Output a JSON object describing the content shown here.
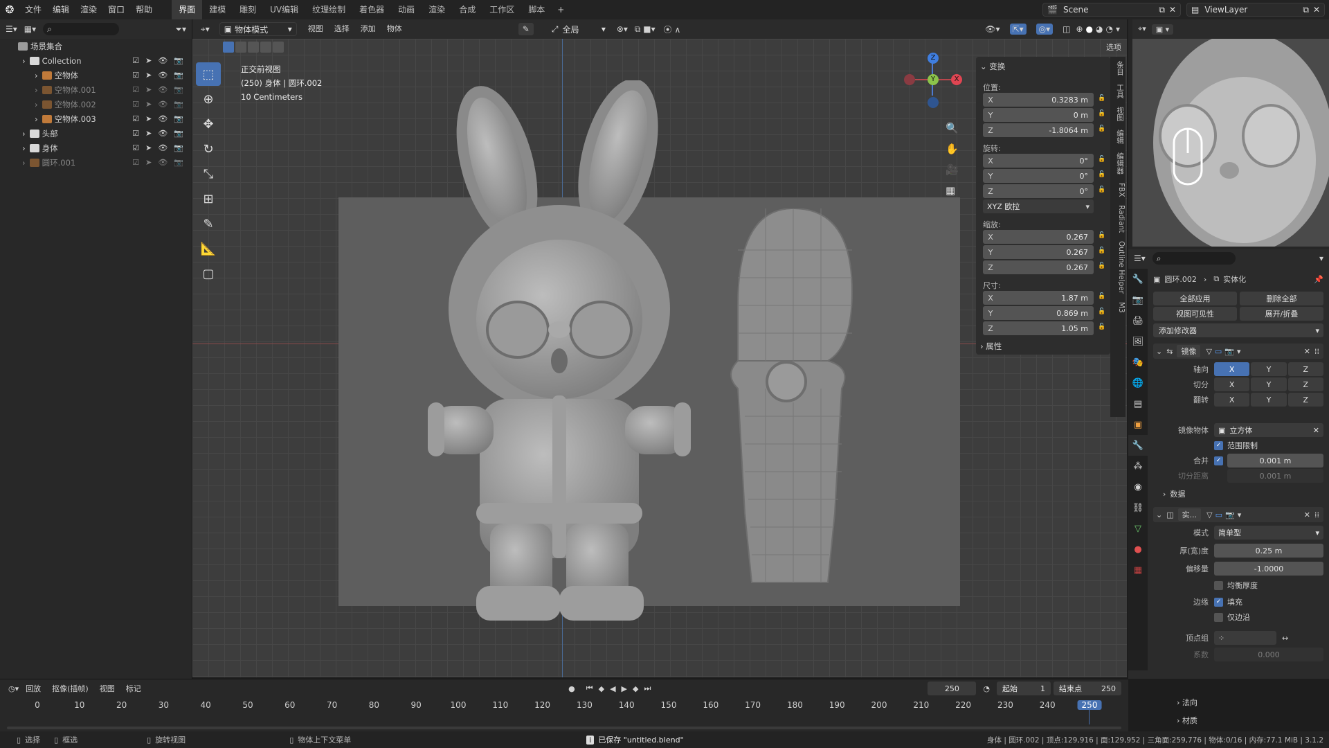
{
  "topbar": {
    "menus": [
      "文件",
      "编辑",
      "渲染",
      "窗口",
      "帮助"
    ],
    "workspaces": [
      "界面",
      "建模",
      "雕刻",
      "UV编辑",
      "纹理绘制",
      "着色器",
      "动画",
      "渲染",
      "合成",
      "工作区",
      "脚本"
    ],
    "add_tab": "+",
    "scene": "Scene",
    "view_layer": "ViewLayer"
  },
  "outliner": {
    "title": "场景集合",
    "rows": [
      {
        "name": "Collection",
        "indent": 1,
        "type": "collection"
      },
      {
        "name": "空物体",
        "indent": 2,
        "type": "empty"
      },
      {
        "name": "空物体.001",
        "indent": 2,
        "type": "empty",
        "dim": true
      },
      {
        "name": "空物体.002",
        "indent": 2,
        "type": "empty",
        "dim": true
      },
      {
        "name": "空物体.003",
        "indent": 2,
        "type": "empty"
      },
      {
        "name": "头部",
        "indent": 1,
        "type": "collection"
      },
      {
        "name": "身体",
        "indent": 1,
        "type": "collection"
      },
      {
        "name": "圆环.001",
        "indent": 1,
        "type": "mesh",
        "dim": true
      }
    ]
  },
  "viewport_header": {
    "mode": "物体模式",
    "menus": [
      "视图",
      "选择",
      "添加",
      "物体"
    ],
    "transform_orient": "全局",
    "options": "选项"
  },
  "viewport_info": {
    "view": "正交前视图",
    "object": "(250) 身体 | 圆环.002",
    "scale": "10 Centimeters"
  },
  "npanel": {
    "header": "变换",
    "location_label": "位置:",
    "location": [
      {
        "ax": "X",
        "v": "0.3283 m"
      },
      {
        "ax": "Y",
        "v": "0 m"
      },
      {
        "ax": "Z",
        "v": "-1.8064 m"
      }
    ],
    "rotation_label": "旋转:",
    "rotation": [
      {
        "ax": "X",
        "v": "0°"
      },
      {
        "ax": "Y",
        "v": "0°"
      },
      {
        "ax": "Z",
        "v": "0°"
      }
    ],
    "rotation_mode": "XYZ 欧拉",
    "scale_label": "缩放:",
    "scale": [
      {
        "ax": "X",
        "v": "0.267"
      },
      {
        "ax": "Y",
        "v": "0.267"
      },
      {
        "ax": "Z",
        "v": "0.267"
      }
    ],
    "dims_label": "尺寸:",
    "dims": [
      {
        "ax": "X",
        "v": "1.87 m"
      },
      {
        "ax": "Y",
        "v": "0.869 m"
      },
      {
        "ax": "Z",
        "v": "1.05 m"
      }
    ],
    "attributes": "属性"
  },
  "side_tabs": [
    "条目",
    "工具",
    "视图",
    "编辑",
    "编辑器",
    "FBX",
    "Radiant",
    "Outline Helper",
    "M3"
  ],
  "properties": {
    "breadcrumb_obj": "圆环.002",
    "breadcrumb_mod": "实体化",
    "apply_all": "全部应用",
    "delete_all": "删除全部",
    "viewport_vis": "视图可见性",
    "expand": "展开/折叠",
    "add_modifier": "添加修改器",
    "mirror": {
      "name": "镜像",
      "axis_label": "轴向",
      "bisect_label": "切分",
      "flip_label": "翻转",
      "axes": [
        "X",
        "Y",
        "Z"
      ],
      "mirror_object_label": "镜像物体",
      "mirror_object": "立方体",
      "clipping": "范围限制",
      "merge_label": "合并",
      "merge_value": "0.001 m",
      "bisect_dist_label": "切分距离",
      "bisect_dist": "0.001 m",
      "data": "数据"
    },
    "solidify": {
      "name": "实...",
      "mode_label": "模式",
      "mode": "简单型",
      "thickness_label": "厚(宽)度",
      "thickness": "0.25 m",
      "offset_label": "偏移量",
      "offset": "-1.0000",
      "even": "均衡厚度",
      "rim_label": "边缘",
      "fill": "填充",
      "only_rim": "仅边沿",
      "vgroup_label": "顶点组",
      "factor_label": "系数",
      "factor": "0.000",
      "normals": "法向",
      "materials": "材质"
    }
  },
  "timeline": {
    "menus": [
      "回放",
      "抠像(插帧)",
      "视图",
      "标记"
    ],
    "current": "250",
    "start_label": "起始",
    "start": "1",
    "end_label": "结束点",
    "end": "250",
    "ticks": [
      "0",
      "10",
      "20",
      "30",
      "40",
      "50",
      "60",
      "70",
      "80",
      "90",
      "100",
      "110",
      "120",
      "130",
      "140",
      "150",
      "160",
      "170",
      "180",
      "190",
      "200",
      "210",
      "220",
      "230",
      "240",
      "250"
    ]
  },
  "statusbar": {
    "select": "选择",
    "box": "框选",
    "rotate": "旋转视图",
    "context": "物体上下文菜单",
    "saved": "已保存 \"untitled.blend\"",
    "stats": "身体 | 圆环.002 | 顶点:129,916 | 面:129,952 | 三角面:259,776 | 物体:0/16 | 内存:77.1 MiB | 3.1.2"
  }
}
